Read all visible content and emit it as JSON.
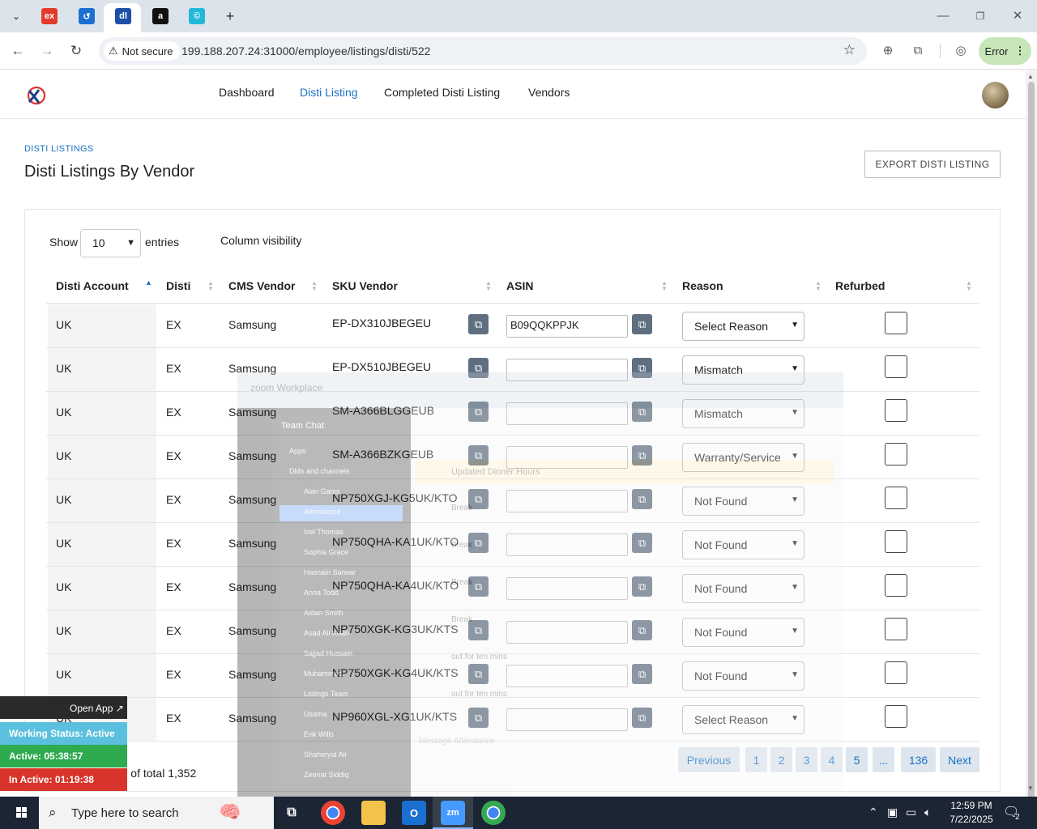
{
  "browser": {
    "tabs": [
      {
        "icon": "ex",
        "icon_name": "ex-favicon",
        "color": "#e23a2f"
      },
      {
        "icon": "↺",
        "icon_name": "blue-arrow-favicon",
        "color": "#1a6fd1"
      },
      {
        "icon": "dl",
        "icon_name": "dl-favicon",
        "color": "#1c4fa8",
        "active": true
      },
      {
        "icon": "a",
        "icon_name": "amazon-favicon",
        "color": "#111111"
      },
      {
        "icon": "©",
        "icon_name": "c-favicon",
        "color": "#22b8d8"
      }
    ],
    "security_label": "Not secure",
    "url": "199.188.207.24:31000/employee/listings/disti/522",
    "error_label": "Error"
  },
  "nav": {
    "links": [
      {
        "label": "Dashboard",
        "active": false
      },
      {
        "label": "Disti Listing",
        "active": true
      },
      {
        "label": "Completed Disti Listing",
        "active": false
      },
      {
        "label": "Vendors",
        "active": false
      }
    ]
  },
  "page": {
    "breadcrumb": "DISTI LISTINGS",
    "title": "Disti Listings By Vendor",
    "export_label": "EXPORT DISTI LISTING"
  },
  "controls": {
    "show_label": "Show",
    "entries_value": "10",
    "entries_label": "entries",
    "column_visibility": "Column visibility"
  },
  "table": {
    "headers": [
      "Disti Account",
      "Disti",
      "CMS Vendor",
      "SKU Vendor",
      "ASIN",
      "Reason",
      "Refurbed"
    ],
    "rows": [
      {
        "account": "UK",
        "disti": "EX",
        "vendor": "Samsung",
        "sku": "EP-DX310JBEGEU",
        "asin": "B09QQKPPJK",
        "reason": "Select Reason"
      },
      {
        "account": "UK",
        "disti": "EX",
        "vendor": "Samsung",
        "sku": "EP-DX510JBEGEU",
        "asin": "",
        "reason": "Mismatch"
      },
      {
        "account": "UK",
        "disti": "EX",
        "vendor": "Samsung",
        "sku": "SM-A366BLGGEUB",
        "asin": "",
        "reason": "Mismatch"
      },
      {
        "account": "UK",
        "disti": "EX",
        "vendor": "Samsung",
        "sku": "SM-A366BZKGEUB",
        "asin": "",
        "reason": "Warranty/Service"
      },
      {
        "account": "UK",
        "disti": "EX",
        "vendor": "Samsung",
        "sku": "NP750XGJ-KG5UK/KTO",
        "asin": "",
        "reason": "Not Found"
      },
      {
        "account": "UK",
        "disti": "EX",
        "vendor": "Samsung",
        "sku": "NP750QHA-KA1UK/KTO",
        "asin": "",
        "reason": "Not Found"
      },
      {
        "account": "UK",
        "disti": "EX",
        "vendor": "Samsung",
        "sku": "NP750QHA-KA4UK/KTO",
        "asin": "",
        "reason": "Not Found"
      },
      {
        "account": "UK",
        "disti": "EX",
        "vendor": "Samsung",
        "sku": "NP750XGK-KG3UK/KTS",
        "asin": "",
        "reason": "Not Found"
      },
      {
        "account": "UK",
        "disti": "EX",
        "vendor": "Samsung",
        "sku": "NP750XGK-KG4UK/KTS",
        "asin": "",
        "reason": "Not Found"
      },
      {
        "account": "UK",
        "disti": "EX",
        "vendor": "Samsung",
        "sku": "NP960XGL-XG1UK/KTS",
        "asin": "",
        "reason": "Select Reason"
      }
    ]
  },
  "footer": {
    "showing": "Showing 1 to 10 of total 1,352",
    "pagination": [
      "Previous",
      "1",
      "2",
      "3",
      "4",
      "5",
      "...",
      "136",
      "Next"
    ]
  },
  "zoom_overlay": {
    "brand": "zoom Workplace",
    "panel_title": "Team Chat",
    "items": [
      "Apps",
      "DMs and channels",
      "Alan Gates",
      "Attendance",
      "Izel Thomas",
      "Sophia Grace",
      "Hasnain Sarwar",
      "Anna Todd",
      "Aidan Smith",
      "Asad Ali Khan",
      "Sajjad Hussain",
      "Muhammad",
      "Listings Team",
      "Usama",
      "Erik Wills",
      "Shaheryal Ali",
      "Zeenat Siddiq"
    ],
    "banner": "Updated Dinner Hours",
    "messages": [
      "Break",
      "Break",
      "Break",
      "Break",
      "out for ten mins",
      "out for ten mins"
    ],
    "compose_placeholder": "Message Attendance"
  },
  "tracker": {
    "open_app": "Open App ↗",
    "working_status": "Working Status: Active",
    "active": "Active: 05:38:57",
    "inactive": "In Active: 01:19:38"
  },
  "taskbar": {
    "search_placeholder": "Type here to search",
    "time": "12:59 PM",
    "date": "7/22/2025",
    "notification_count": "2"
  },
  "colors": {
    "accent": "#1a73c8",
    "copy_button": "#5f6f80",
    "working": "#5bc0de",
    "active": "#2eaa4f",
    "inactive": "#d9342b"
  }
}
